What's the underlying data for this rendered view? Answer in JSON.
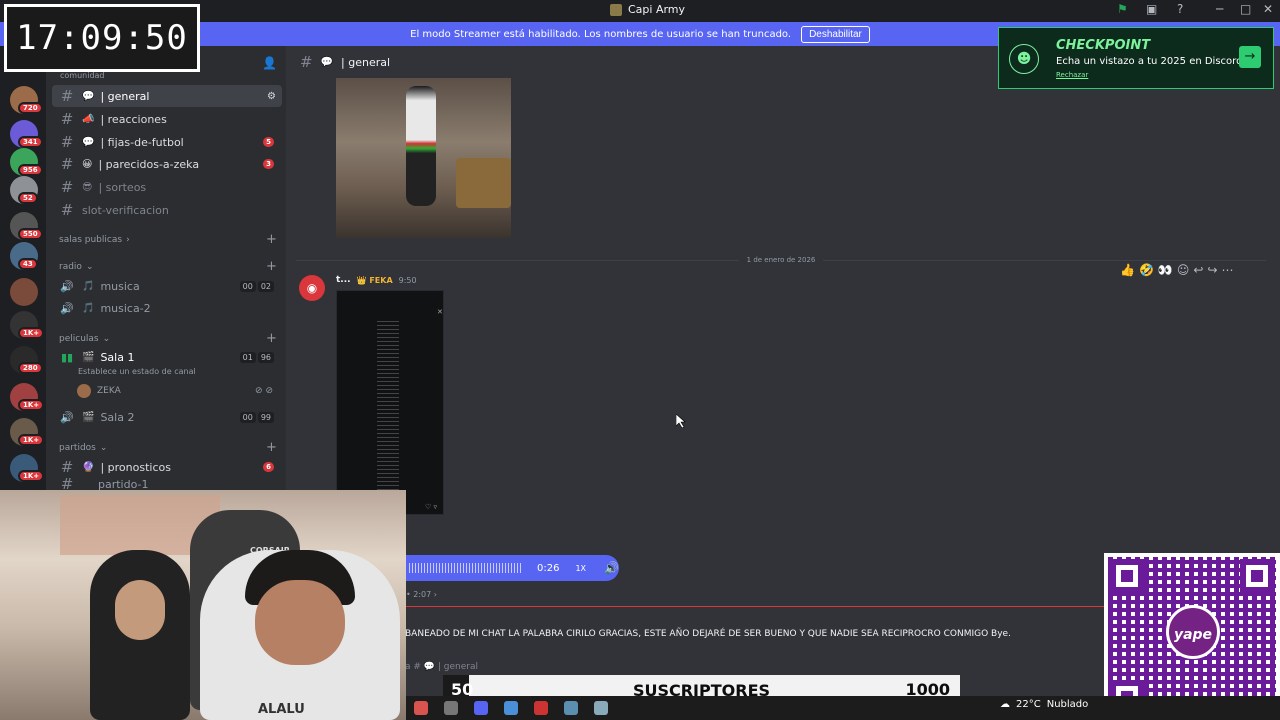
{
  "window": {
    "title": "Capi Army"
  },
  "streamer_bar": {
    "text": "El modo Streamer está habilitado. Los nombres de usuario se han truncado.",
    "button": "Deshabilitar"
  },
  "server_badges": [
    "720",
    "341",
    "956",
    "52",
    "550",
    "43",
    "1K+",
    "280",
    "1K+",
    "1K+",
    "1K+"
  ],
  "channels": {
    "server_name": "Capi Army",
    "top_category": "comunidad",
    "items": [
      {
        "name": "| general",
        "emoji": "💬",
        "active": true
      },
      {
        "name": "| reacciones",
        "emoji": "📣",
        "active": false
      },
      {
        "name": "| fijas-de-futbol",
        "emoji": "💬",
        "badge": "5"
      },
      {
        "name": "| parecidos-a-zeka",
        "emoji": "😀",
        "badge": "3"
      },
      {
        "name": "| sorteos",
        "emoji": "😎",
        "muted": true
      },
      {
        "name": "slot-verificacion",
        "muted": true
      }
    ],
    "salas_publicas": "salas publicas",
    "radio": "radio",
    "voice": [
      {
        "name": "musica",
        "c1": "00",
        "c2": "02"
      },
      {
        "name": "musica-2"
      }
    ],
    "peliculas": "peliculas",
    "sala1": {
      "name": "Sala 1",
      "c1": "01",
      "c2": "96",
      "status": "Establece un estado de canal",
      "member": "ZEKA"
    },
    "sala2": {
      "name": "Sala 2",
      "c1": "00",
      "c2": "99"
    },
    "partidos": "partidos",
    "pronosticos": {
      "name": "| pronosticos",
      "badge": "6"
    },
    "partido": "partido-1"
  },
  "chat": {
    "channel": "| general",
    "date_divider": "1 de enero de 2026",
    "author": "t...",
    "role_tag": "FEKA",
    "time": "9:50",
    "audio_time": "0:26",
    "audio_speed": "1X",
    "duration": "2:07",
    "ticker": "BANEADO DE MI CHAT LA PALABRA CIRILO GRACIAS, ESTE AÑO DEJARÉ DE SER BUENO Y QUE NADIE SEA RECIPROCRO CONMIGO Bye.",
    "input_placeholder": "general"
  },
  "timer": "17:09:50",
  "checkpoint": {
    "title": "CHECKPOINT",
    "subtitle": "Echa un vistazo a tu 2025 en Discord",
    "dismiss": "Rechazar"
  },
  "qr": {
    "logo": "yape"
  },
  "webcam": {
    "chair_brand": "CORSAIR",
    "shirt_text": "ALALU"
  },
  "sub_goal": {
    "current": "50",
    "label": "SUSCRIPTORES",
    "goal": "1000",
    "progress_fraction": 0.05
  },
  "weather": {
    "temp": "22°C",
    "condition": "Nublado"
  }
}
